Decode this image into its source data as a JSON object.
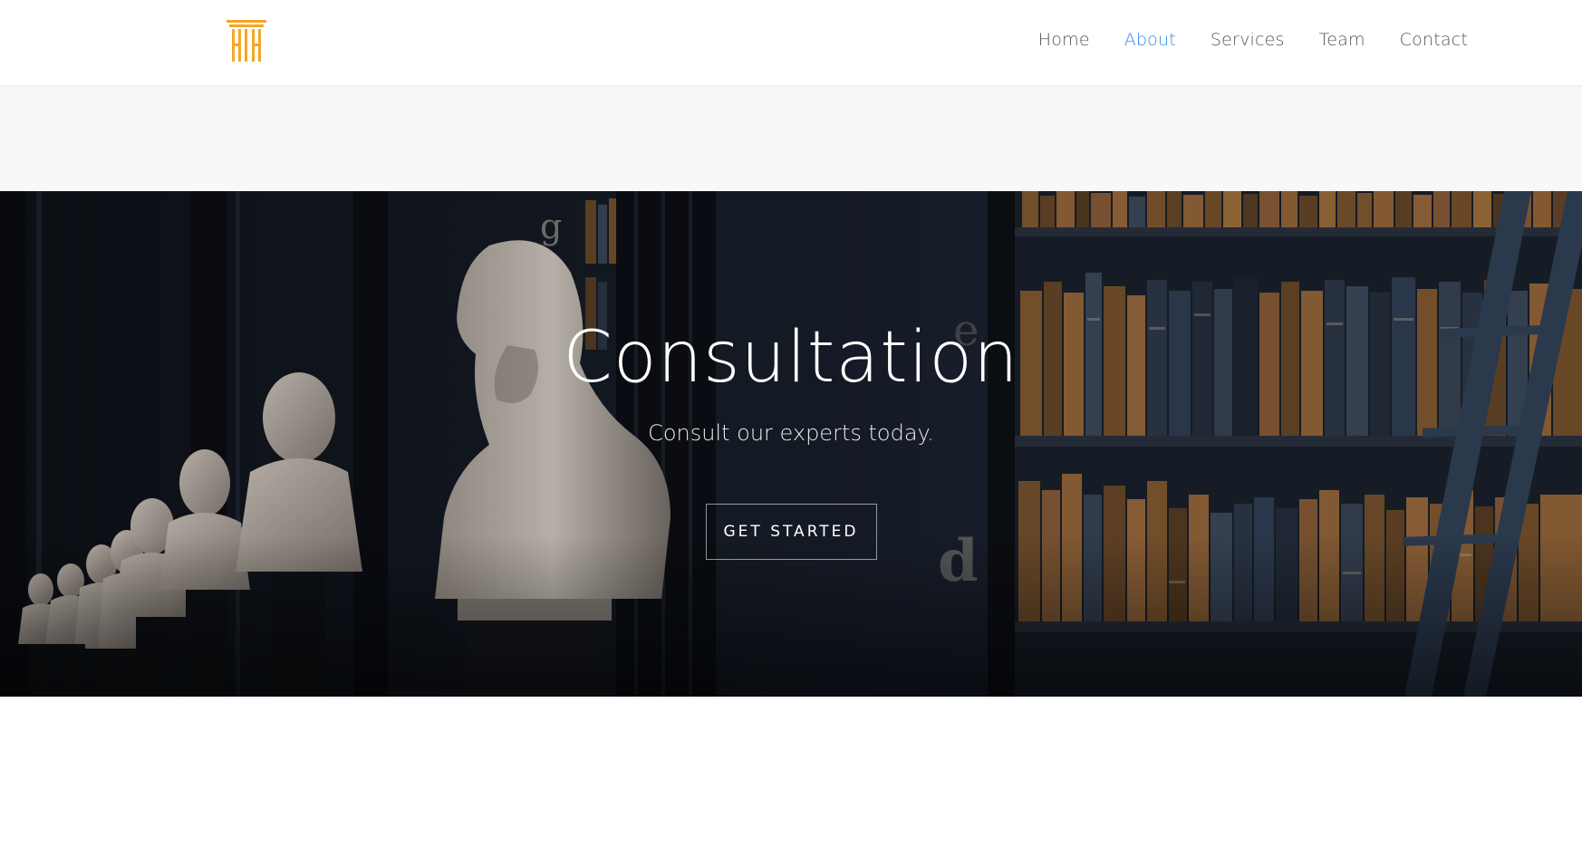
{
  "brand": {
    "logo_icon": "column-pillar-icon",
    "logo_color": "#f6a623"
  },
  "nav": {
    "items": [
      {
        "label": "Home",
        "active": false
      },
      {
        "label": "About",
        "active": true
      },
      {
        "label": "Services",
        "active": false
      },
      {
        "label": "Team",
        "active": false
      },
      {
        "label": "Contact",
        "active": false
      }
    ],
    "active_color": "#2f8fe8"
  },
  "hero": {
    "title": "Consultation",
    "subtitle": "Consult our experts today.",
    "cta_label": "GET STARTED",
    "background_image": "library-busts-bookshelves"
  }
}
